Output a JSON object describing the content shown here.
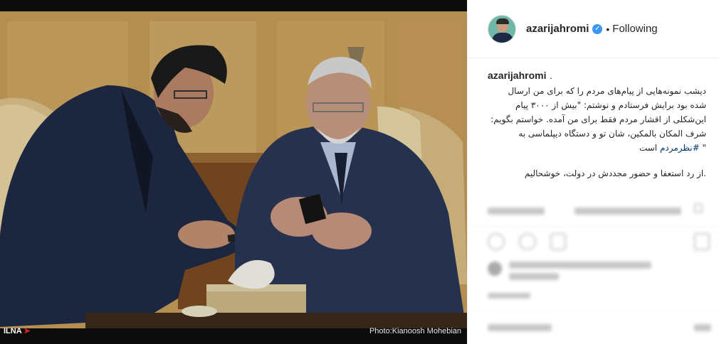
{
  "post": {
    "username": "azarijahromi",
    "follow_label": "Following",
    "dot": "•",
    "verified_icon": "verified-badge-icon",
    "caption_user": "azarijahromi",
    "caption_dot": ".",
    "caption_lines": [
      "دیشب نمونه‌هایی از پیام‌های مردم را که برای من ارسال",
      "شده بود برایش فرستادم و نوشتم: \"بیش از ۳۰۰۰ پیام",
      "این‌شکلی از اقشار مردم فقط برای من آمده. خواستم بگویم:",
      "شرف المکان بالمکین، شان تو و دستگاه دیپلماسی به"
    ],
    "caption_hashtag_line_prefix": "\" ",
    "caption_hashtag": "#نظرمردم",
    "caption_hashtag_line_suffix": " است",
    "caption_last": ".از رد استعفا و حضور مجددش در دولت، خوشحالیم"
  },
  "photo": {
    "credit": "Photo:Kianoosh Mohebian",
    "agency": "ILNA",
    "agency_arrow": "➤"
  },
  "colors": {
    "accent": "#3897f0",
    "hashtag": "#003569",
    "agency_red": "#e0202b"
  }
}
